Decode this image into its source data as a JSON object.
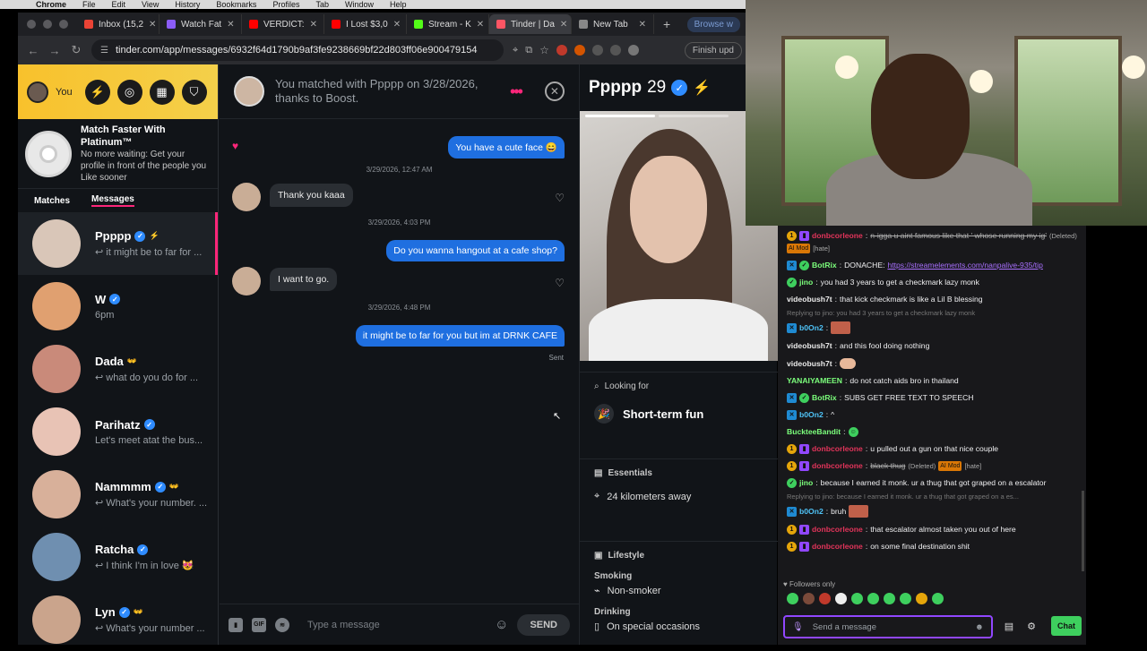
{
  "menubar": [
    "Chrome",
    "File",
    "Edit",
    "View",
    "History",
    "Bookmarks",
    "Profiles",
    "Tab",
    "Window",
    "Help"
  ],
  "tabs": [
    {
      "label": "Inbox (15,2",
      "color": "#ea4335"
    },
    {
      "label": "Watch Fat",
      "color": "#8b5cf6"
    },
    {
      "label": "VERDICT:",
      "color": "#ff0000"
    },
    {
      "label": "I Lost $3,0",
      "color": "#ff0000"
    },
    {
      "label": "Stream - K",
      "color": "#53fc18"
    },
    {
      "label": "Tinder | Da",
      "color": "#fd5564",
      "active": true
    },
    {
      "label": "New Tab",
      "color": "#888888"
    }
  ],
  "browse_label": "Browse w",
  "url": "tinder.com/app/messages/6932f64d1790b9af3fe9238669bf22d803ff06e900479154",
  "finish_label": "Finish upd",
  "sidebar": {
    "me_label": "You",
    "promo_title": "Match Faster With Platinum™",
    "promo_body": "No more waiting: Get your profile in front of the people you Like sooner",
    "tab_matches": "Matches",
    "tab_messages": "Messages",
    "conversations": [
      {
        "name": "Ppppp",
        "preview": "↩ it might be to far for ...",
        "color": "#d9c6b8",
        "extra": "⚡"
      },
      {
        "name": "W",
        "preview": "6pm",
        "color": "#e0a070",
        "extra": ""
      },
      {
        "name": "Dada",
        "preview": "↩ what do you do for ...",
        "color": "#c98a7a",
        "extra": "👐"
      },
      {
        "name": "Parihatz",
        "preview": "Let's meet atat the bus...",
        "color": "#e8c3b5",
        "extra": ""
      },
      {
        "name": "Nammmm",
        "preview": "↩ What's your number. ...",
        "color": "#d8b09a",
        "extra": "👐"
      },
      {
        "name": "Ratcha",
        "preview": "↩ I think I'm in love 😻",
        "color": "#6f8fb0",
        "extra": ""
      },
      {
        "name": "Lyn",
        "preview": "↩ What's your number ...",
        "color": "#caa48c",
        "extra": "👐"
      }
    ]
  },
  "chat": {
    "header": "You matched with Ppppp on 3/28/2026, thanks to Boost.",
    "messages": {
      "m1": "You have a cute face 😄",
      "t1": "3/29/2026, 12:47 AM",
      "m2": "Thank you kaaa",
      "t2": "3/29/2026, 4:03 PM",
      "m3": "Do you wanna hangout at a cafe shop?",
      "m4": "I want to go.",
      "t3": "3/29/2026, 4:48 PM",
      "m5": "it might be to far for you but im at DRNK CAFE",
      "sent": "Sent"
    },
    "composer_placeholder": "Type a message",
    "gif_label": "GIF",
    "send_label": "SEND"
  },
  "profile": {
    "name": "Ppppp",
    "age": "29",
    "looking_for_label": "Looking for",
    "looking_for_value": "Short-term fun",
    "essentials_label": "Essentials",
    "distance": "24 kilometers away",
    "lifestyle_label": "Lifestyle",
    "smoking_label": "Smoking",
    "smoking_value": "Non-smoker",
    "drinking_label": "Drinking",
    "drinking_value": "On special occasions"
  },
  "twitch": {
    "lines": {
      "l1_user": "donbcorleone",
      "l1_text": "n-igga u aint famous like that ' whose running my ig'",
      "l1_del": "(Deleted)",
      "l1_mod": "AI Mod",
      "l1_tag": "[hate]",
      "l2_user": "BotRix",
      "l2_text": "DONACHE:",
      "l2_link": "https://streamelements.com/nanpalive-935/tip",
      "l3_user": "jino",
      "l3_text": "you had 3 years to get a checkmark lazy monk",
      "l4_user": "videobush7t",
      "l4_text": "that kick checkmark is like a Lil B blessing",
      "l5_reply": "Replying to jino: you had 3 years to get a checkmark lazy monk",
      "l5_user": "b0On2",
      "l6_user": "videobush7t",
      "l6_text": "and this fool doing nothing",
      "l7_user": "videobush7t",
      "l8_user": "YANAIYAMEEN",
      "l8_text": "do not catch aids bro in thailand",
      "l9_user": "BotRix",
      "l9_text": "SUBS GET FREE TEXT TO SPEECH",
      "l10_user": "b0On2",
      "l10_text": "^",
      "l11_user": "BuckteeBandit",
      "l12_user": "donbcorleone",
      "l12_text": "u pulled out a gun on that nice couple",
      "l13_user": "donbcorleone",
      "l13_text": "black thug",
      "l13_del": "(Deleted)",
      "l13_mod": "AI Mod",
      "l13_tag": "[hate]",
      "l14_user": "jino",
      "l14_text": "because I earned it monk. ur a thug that got graped on a escalator",
      "l15_reply": "Replying to jino: because I earned it monk. ur a thug that got graped on a es...",
      "l15_user": "b0On2",
      "l15_text": "bruh",
      "l16_user": "donbcorleone",
      "l16_text": "that escalator almost taken you out of here",
      "l17_user": "donbcorleone",
      "l17_text": "on some final destination shit"
    },
    "followers_only": "Followers only",
    "send_placeholder": "Send a message",
    "chat_button": "Chat"
  }
}
